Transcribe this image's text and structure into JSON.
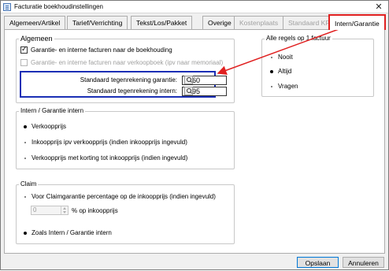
{
  "window": {
    "title": "Facturatie boekhoudinstellingen",
    "close_glyph": "✕"
  },
  "tabs": [
    {
      "label": "Algemeen/Artikel",
      "state": "normal"
    },
    {
      "label": "Tarief/Verrichting",
      "state": "normal"
    },
    {
      "label": "Tekst/Los/Pakket",
      "state": "normal"
    },
    {
      "label": "Overige",
      "state": "normal"
    },
    {
      "label": "Kostenplaats",
      "state": "disabled"
    },
    {
      "label": "Standaard KP",
      "state": "disabled"
    },
    {
      "label": "Intern/Garantie",
      "state": "active"
    }
  ],
  "general": {
    "legend": "Algemeen",
    "checkbox_booking": {
      "label": "Garantie- en interne facturen naar de boekhouding",
      "checked": true
    },
    "checkbox_sales_book": {
      "label": "Garantie- en interne facturen naar verkoopboek (ipv naar memoriaal)",
      "checked": false,
      "disabled": true
    },
    "warranty_account": {
      "label": "Standaard tegenrekening garantie:",
      "value": "5060"
    },
    "internal_account": {
      "label": "Standaard tegenrekening intern:",
      "value": "5295"
    }
  },
  "per_invoice": {
    "legend": "Alle regels op 1 factuur",
    "options": [
      {
        "label": "Nooit",
        "selected": false
      },
      {
        "label": "Altijd",
        "selected": true
      },
      {
        "label": "Vragen",
        "selected": false
      }
    ]
  },
  "internal_warranty": {
    "legend": "Intern / Garantie intern",
    "options": [
      {
        "label": "Verkoopprijs",
        "selected": true
      },
      {
        "label": "Inkoopprijs ipv verkoopprijs (indien inkoopprijs ingevuld)",
        "selected": false
      },
      {
        "label": "Verkoopprijs met korting tot inkoopprijs  (indien ingevuld)",
        "selected": false
      }
    ]
  },
  "claim": {
    "legend": "Claim",
    "option_percentage": {
      "label": "Voor Claimgarantie percentage op de inkoopprijs  (indien ingevuld)",
      "selected": false
    },
    "percentage_value": "0",
    "percentage_suffix": "% op inkoopprijs",
    "option_same": {
      "label": "Zoals Intern / Garantie intern",
      "selected": true
    }
  },
  "footer": {
    "save_label": "Opslaan",
    "cancel_label": "Annuleren"
  },
  "colors": {
    "annotation_red": "#e02020",
    "annotation_blue": "#1b2fb5"
  }
}
